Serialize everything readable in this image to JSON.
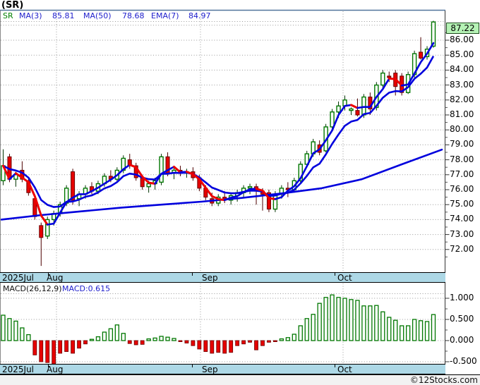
{
  "title": "(SR)",
  "legend": {
    "symbol": "SR",
    "ma3_label": "MA(3)",
    "ma3_value": "85.81",
    "ma50_label": "MA(50)",
    "ma50_value": "78.68",
    "ema7_label": "EMA(7)",
    "ema7_value": "84.97"
  },
  "macd_legend": {
    "label": "MACD(26,12,9)",
    "value": "MACD:0.615"
  },
  "price_box": {
    "value": "87.22"
  },
  "footer": {
    "copyright": "©12Stocks.com"
  },
  "colors": {
    "up": "#007700",
    "up_wick": "#003300",
    "down": "#e60000",
    "down_border": "#6b0000",
    "down_wick": "#4d0000",
    "ma_fast_up": "#0000dd",
    "ma_fast_down": "#ee0000",
    "ma_slow": "#0000dd",
    "grid": "#999999",
    "frame": "#8a8a8a",
    "accent_navy": "#51749b",
    "band": "#add8e6",
    "price_box_bg": "#b5f2b5",
    "legend_blue": "#2020cc",
    "legend_green": "#008000",
    "footer_bg": "#f2f2f2"
  },
  "chart_data": {
    "type": "candlestick",
    "title": "(SR)",
    "x_axis": {
      "months": [
        "2025Jul",
        "Aug",
        "Sep",
        "Oct"
      ]
    },
    "price_axis": {
      "ticks": [
        86,
        85,
        84,
        83,
        82,
        81,
        80,
        79,
        78,
        77,
        76,
        75,
        74,
        73,
        72
      ],
      "minor_step": 0.5,
      "last_price": 87.22
    },
    "macd_axis": {
      "ticks": [
        1.0,
        0.5,
        0.0,
        -0.5
      ]
    },
    "indicators": {
      "ma3_last": 85.81,
      "ma50_last": 78.68,
      "ema7_last": 84.97,
      "macd_last": 0.615,
      "ma50_path": [
        74.0,
        74.3,
        74.55,
        74.8,
        75.0,
        75.2,
        75.45,
        75.75,
        76.1,
        76.7,
        77.7,
        78.68
      ]
    },
    "candles_ohlc": [
      [
        76.6,
        78.7,
        76.3,
        77.6
      ],
      [
        78.2,
        78.4,
        76.5,
        76.7
      ],
      [
        76.7,
        77.2,
        76.2,
        77.0
      ],
      [
        77.3,
        77.9,
        76.5,
        76.7
      ],
      [
        76.6,
        76.8,
        75.6,
        75.8
      ],
      [
        75.4,
        75.6,
        74.0,
        74.2
      ],
      [
        73.6,
        73.8,
        70.9,
        72.8
      ],
      [
        72.9,
        74.2,
        72.7,
        74.0
      ],
      [
        74.0,
        74.6,
        73.6,
        74.4
      ],
      [
        74.4,
        75.2,
        74.2,
        75.0
      ],
      [
        75.1,
        76.3,
        74.9,
        76.1
      ],
      [
        77.2,
        77.4,
        75.0,
        75.3
      ],
      [
        75.4,
        75.9,
        74.9,
        75.7
      ],
      [
        75.7,
        76.3,
        75.4,
        76.1
      ],
      [
        76.2,
        76.5,
        75.7,
        75.9
      ],
      [
        75.9,
        76.6,
        75.7,
        76.4
      ],
      [
        76.4,
        77.1,
        76.2,
        76.9
      ],
      [
        76.9,
        77.3,
        76.5,
        76.7
      ],
      [
        76.7,
        77.5,
        76.5,
        77.3
      ],
      [
        77.3,
        78.3,
        77.1,
        78.1
      ],
      [
        78.0,
        78.4,
        77.4,
        77.6
      ],
      [
        77.6,
        77.8,
        76.6,
        76.8
      ],
      [
        76.8,
        77.0,
        76.0,
        76.2
      ],
      [
        76.2,
        76.6,
        75.8,
        76.4
      ],
      [
        76.4,
        76.8,
        76.0,
        76.6
      ],
      [
        76.5,
        78.4,
        76.3,
        78.2
      ],
      [
        78.2,
        78.5,
        76.9,
        77.1
      ],
      [
        77.1,
        77.5,
        76.7,
        77.3
      ],
      [
        77.3,
        77.6,
        76.9,
        77.1
      ],
      [
        77.1,
        77.4,
        76.8,
        77.2
      ],
      [
        77.2,
        77.5,
        76.6,
        76.8
      ],
      [
        76.8,
        77.0,
        75.9,
        76.1
      ],
      [
        76.1,
        76.3,
        75.3,
        75.5
      ],
      [
        75.4,
        75.8,
        74.9,
        75.1
      ],
      [
        75.1,
        75.7,
        74.9,
        75.5
      ],
      [
        75.5,
        75.9,
        75.1,
        75.3
      ],
      [
        75.3,
        75.8,
        75.0,
        75.6
      ],
      [
        75.6,
        76.0,
        75.2,
        75.8
      ],
      [
        75.8,
        76.3,
        75.5,
        76.1
      ],
      [
        76.1,
        76.4,
        75.7,
        76.2
      ],
      [
        76.2,
        76.4,
        75.0,
        75.9
      ],
      [
        75.9,
        76.1,
        74.6,
        75.7
      ],
      [
        75.8,
        76.0,
        74.5,
        74.7
      ],
      [
        74.7,
        75.9,
        74.5,
        75.7
      ],
      [
        75.7,
        76.3,
        75.4,
        76.1
      ],
      [
        76.1,
        76.5,
        75.5,
        76.0
      ],
      [
        76.0,
        76.8,
        75.8,
        76.6
      ],
      [
        76.6,
        77.9,
        76.4,
        77.7
      ],
      [
        77.7,
        78.6,
        77.5,
        78.4
      ],
      [
        78.4,
        79.4,
        78.2,
        79.2
      ],
      [
        79.0,
        79.3,
        78.3,
        78.5
      ],
      [
        78.6,
        80.4,
        78.5,
        80.2
      ],
      [
        80.2,
        81.4,
        80.0,
        81.2
      ],
      [
        81.2,
        81.9,
        80.8,
        81.6
      ],
      [
        81.6,
        82.3,
        81.3,
        82.0
      ],
      [
        81.3,
        81.5,
        81.0,
        81.4
      ],
      [
        81.3,
        82.1,
        80.9,
        81.0
      ],
      [
        81.0,
        82.4,
        80.8,
        82.2
      ],
      [
        82.2,
        82.5,
        81.0,
        81.4
      ],
      [
        81.5,
        83.2,
        81.3,
        83.0
      ],
      [
        83.0,
        84.0,
        82.8,
        83.8
      ],
      [
        83.6,
        83.9,
        83.2,
        83.5
      ],
      [
        83.8,
        84.0,
        82.3,
        82.9
      ],
      [
        83.6,
        83.8,
        82.3,
        82.5
      ],
      [
        82.5,
        83.9,
        82.4,
        83.7
      ],
      [
        83.7,
        85.3,
        83.5,
        85.1
      ],
      [
        85.2,
        86.2,
        84.7,
        84.8
      ],
      [
        84.9,
        85.6,
        84.7,
        85.4
      ],
      [
        85.6,
        87.3,
        85.5,
        87.22
      ]
    ],
    "macd_values": [
      0.6,
      0.52,
      0.46,
      0.3,
      0.14,
      -0.34,
      -0.5,
      -0.52,
      -0.55,
      -0.3,
      -0.26,
      -0.3,
      -0.18,
      -0.08,
      0.03,
      0.09,
      0.2,
      0.28,
      0.37,
      0.17,
      -0.07,
      -0.1,
      -0.09,
      0.04,
      0.06,
      0.1,
      0.08,
      0.05,
      -0.02,
      -0.06,
      -0.12,
      -0.2,
      -0.26,
      -0.3,
      -0.28,
      -0.3,
      -0.28,
      -0.12,
      -0.08,
      -0.04,
      -0.22,
      -0.12,
      -0.04,
      -0.02,
      0.04,
      0.07,
      0.15,
      0.35,
      0.52,
      0.62,
      0.88,
      1.02,
      1.08,
      1.02,
      1.0,
      0.97,
      0.95,
      0.82,
      0.82,
      0.83,
      0.68,
      0.55,
      0.48,
      0.35,
      0.35,
      0.5,
      0.47,
      0.45,
      0.615
    ]
  }
}
